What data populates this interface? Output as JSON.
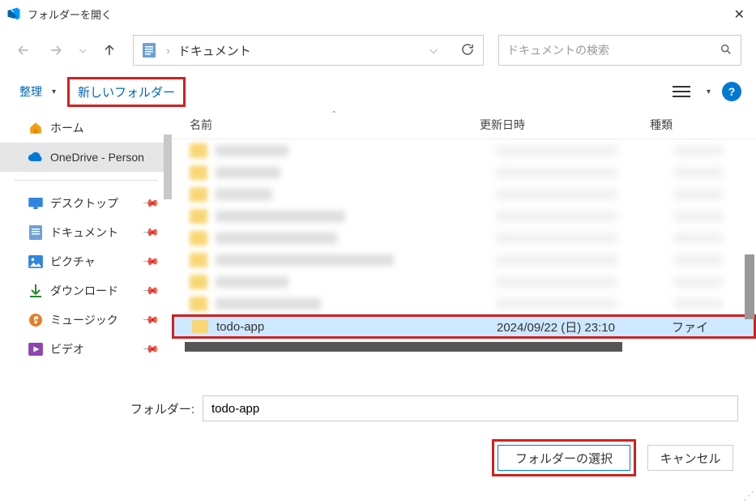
{
  "titlebar": {
    "title": "フォルダーを開く"
  },
  "path": {
    "current": "ドキュメント"
  },
  "search": {
    "placeholder": "ドキュメントの検索"
  },
  "toolbar": {
    "organize": "整理",
    "new_folder": "新しいフォルダー"
  },
  "sidebar": {
    "home": "ホーム",
    "onedrive": "OneDrive - Person",
    "desktop": "デスクトップ",
    "documents": "ドキュメント",
    "pictures": "ピクチャ",
    "downloads": "ダウンロード",
    "music": "ミュージック",
    "videos": "ビデオ"
  },
  "columns": {
    "name": "名前",
    "modified": "更新日時",
    "type": "種類"
  },
  "selected": {
    "name": "todo-app",
    "modified": "2024/09/22 (日) 23:10",
    "type": "ファイ"
  },
  "footer": {
    "label": "フォルダー:",
    "value": "todo-app",
    "select": "フォルダーの選択",
    "cancel": "キャンセル"
  }
}
